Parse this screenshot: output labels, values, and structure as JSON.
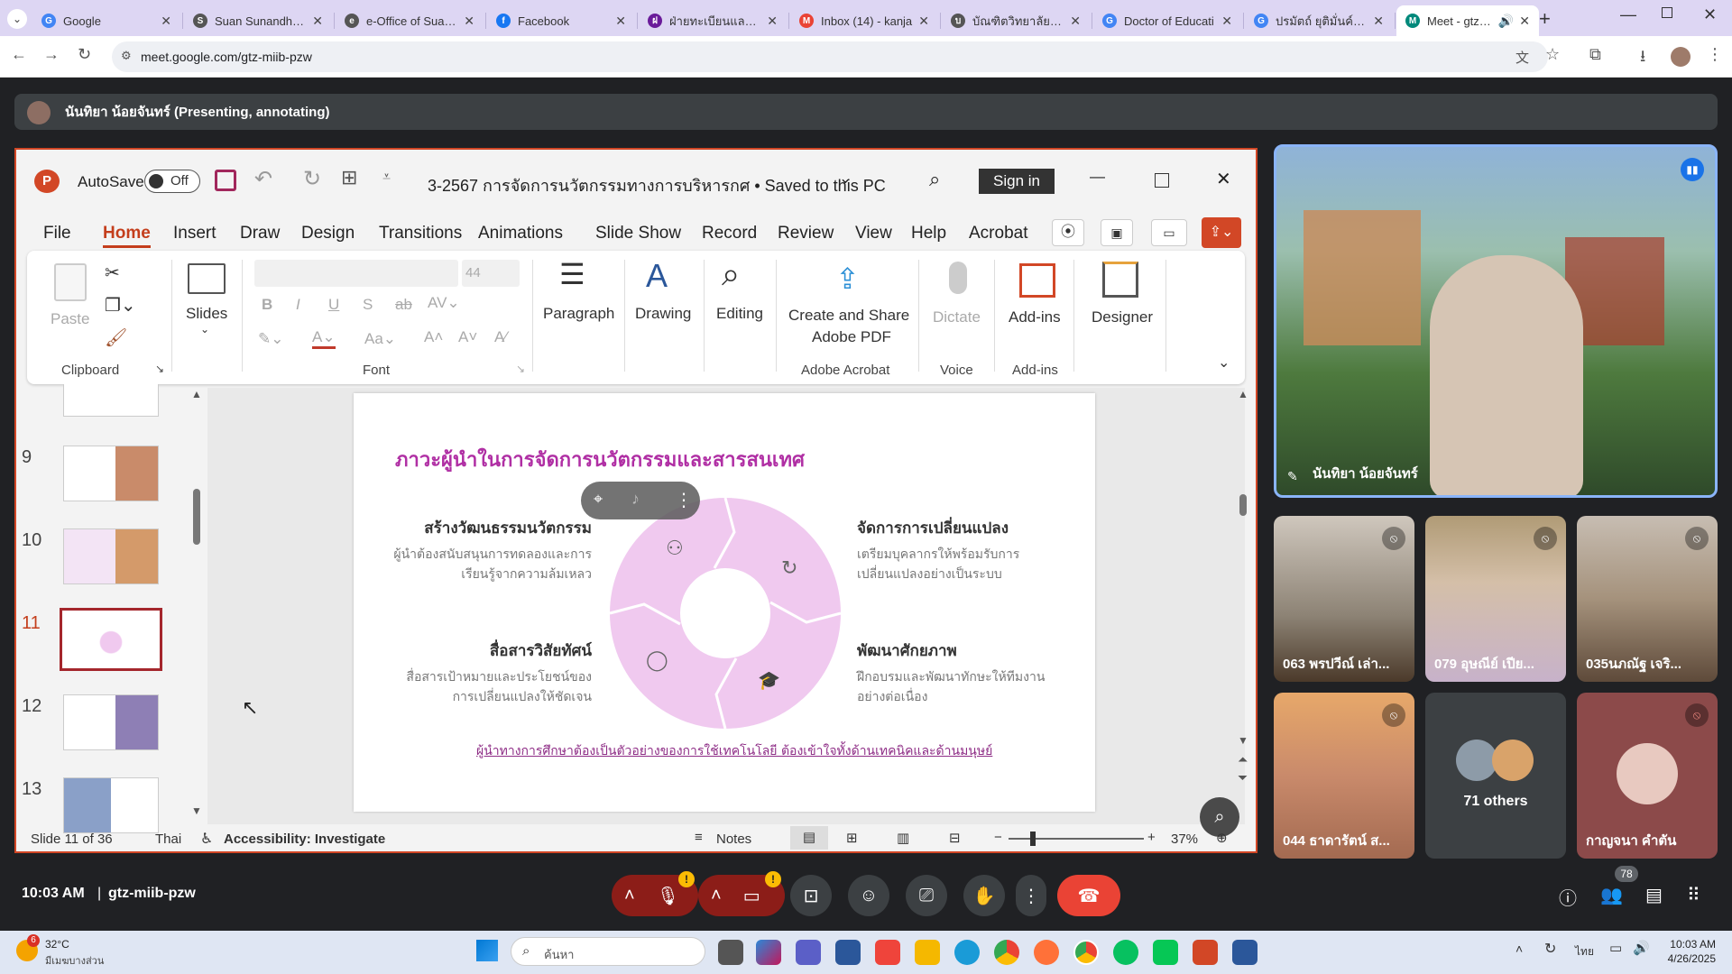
{
  "browser": {
    "tabs": [
      {
        "title": "Google",
        "color": "#4285f4",
        "letter": "G"
      },
      {
        "title": "Suan Sunandha R",
        "color": "#555555",
        "letter": "S"
      },
      {
        "title": "e-Office of Suan S",
        "color": "#555555",
        "letter": "e"
      },
      {
        "title": "Facebook",
        "color": "#1877f2",
        "letter": "f"
      },
      {
        "title": "ฝ่ายทะเบียนและประเ",
        "color": "#6a1b9a",
        "letter": "ฝ"
      },
      {
        "title": "Inbox (14) - kanja",
        "color": "#ea4335",
        "letter": "M"
      },
      {
        "title": "บัณฑิตวิทยาลัย มหา",
        "color": "#555555",
        "letter": "บ"
      },
      {
        "title": "Doctor of Educati",
        "color": "#4285f4",
        "letter": "G"
      },
      {
        "title": "ปรมัตถ์ ยุติมั่นค์ - ต้",
        "color": "#4285f4",
        "letter": "G"
      },
      {
        "title": "Meet - gtz-m",
        "color": "#00897b",
        "letter": "M"
      }
    ],
    "url": "meet.google.com/gtz-miib-pzw"
  },
  "presenter_bar": {
    "text": "นันทิยา น้อยจันทร์ (Presenting, annotating)"
  },
  "ppt": {
    "autosave_label": "AutoSave",
    "autosave_state": "Off",
    "doc_title": "3-2567 การจัดการนวัตกรรมทางการบริหารกศ • Saved to this PC",
    "signin": "Sign in",
    "menu": [
      "File",
      "Home",
      "Insert",
      "Draw",
      "Design",
      "Transitions",
      "Animations",
      "Slide Show",
      "Record",
      "Review",
      "View",
      "Help",
      "Acrobat"
    ],
    "ribbon": {
      "paste": "Paste",
      "slides": "Slides",
      "font_size": "44",
      "paragraph": "Paragraph",
      "drawing": "Drawing",
      "editing": "Editing",
      "create_share_1": "Create and Share",
      "create_share_2": "Adobe PDF",
      "dictate": "Dictate",
      "addins": "Add-ins",
      "designer": "Designer",
      "groups": {
        "clipboard": "Clipboard",
        "font": "Font",
        "acrobat": "Adobe Acrobat",
        "voice": "Voice",
        "addins": "Add-ins"
      }
    },
    "thumbnails": [
      {
        "num": "9"
      },
      {
        "num": "10"
      },
      {
        "num": "11"
      },
      {
        "num": "12"
      },
      {
        "num": "13"
      }
    ],
    "slide": {
      "title": "ภาวะผู้นำในการจัดการนวัตกรรมและสารสนเทศ",
      "tl_head": "สร้างวัฒนธรรมนวัตกรรม",
      "tl_body1": "ผู้นำต้องสนับสนุนการทดลองและการ",
      "tl_body2": "เรียนรู้จากความล้มเหลว",
      "tr_head": "จัดการการเปลี่ยนแปลง",
      "tr_body1": "เตรียมบุคลากรให้พร้อมรับการ",
      "tr_body2": "เปลี่ยนแปลงอย่างเป็นระบบ",
      "bl_head": "สื่อสารวิสัยทัศน์",
      "bl_body1": "สื่อสารเป้าหมายและประโยชน์ของ",
      "bl_body2": "การเปลี่ยนแปลงให้ชัดเจน",
      "br_head": "พัฒนาศักยภาพ",
      "br_body1": "ฝึกอบรมและพัฒนาทักษะให้ทีมงาน",
      "br_body2": "อย่างต่อเนื่อง",
      "footer": "ผู้นำทางการศึกษาต้องเป็นตัวอย่างของการใช้เทคโนโลยี ต้องเข้าใจทั้งด้านเทคนิคและด้านมนุษย์"
    },
    "status": {
      "slide_info": "Slide 11 of 36",
      "language": "Thai",
      "accessibility": "Accessibility: Investigate",
      "notes": "Notes",
      "zoom": "37%"
    }
  },
  "participants": {
    "main": {
      "name": "นันทิยา น้อยจันทร์"
    },
    "tiles": [
      {
        "name": "063 พรปวีณ์ เล่า..."
      },
      {
        "name": "079 อุษณีย์ เปีย..."
      },
      {
        "name": "035นภณัฐ เจริ..."
      },
      {
        "name": "044 ธาดารัตน์ ส..."
      },
      {
        "name": "71 others"
      },
      {
        "name": "กาญจนา คำตัน"
      }
    ]
  },
  "meeting": {
    "time": "10:03 AM",
    "sep": "|",
    "code": "gtz-miib-pzw",
    "people_count": "78"
  },
  "taskbar": {
    "temp": "32°C",
    "weather": "มีเมฆบางส่วน",
    "weather_badge": "6",
    "search": "ค้นหา",
    "lang": "ไทย",
    "time": "10:03 AM",
    "date": "4/26/2025"
  }
}
